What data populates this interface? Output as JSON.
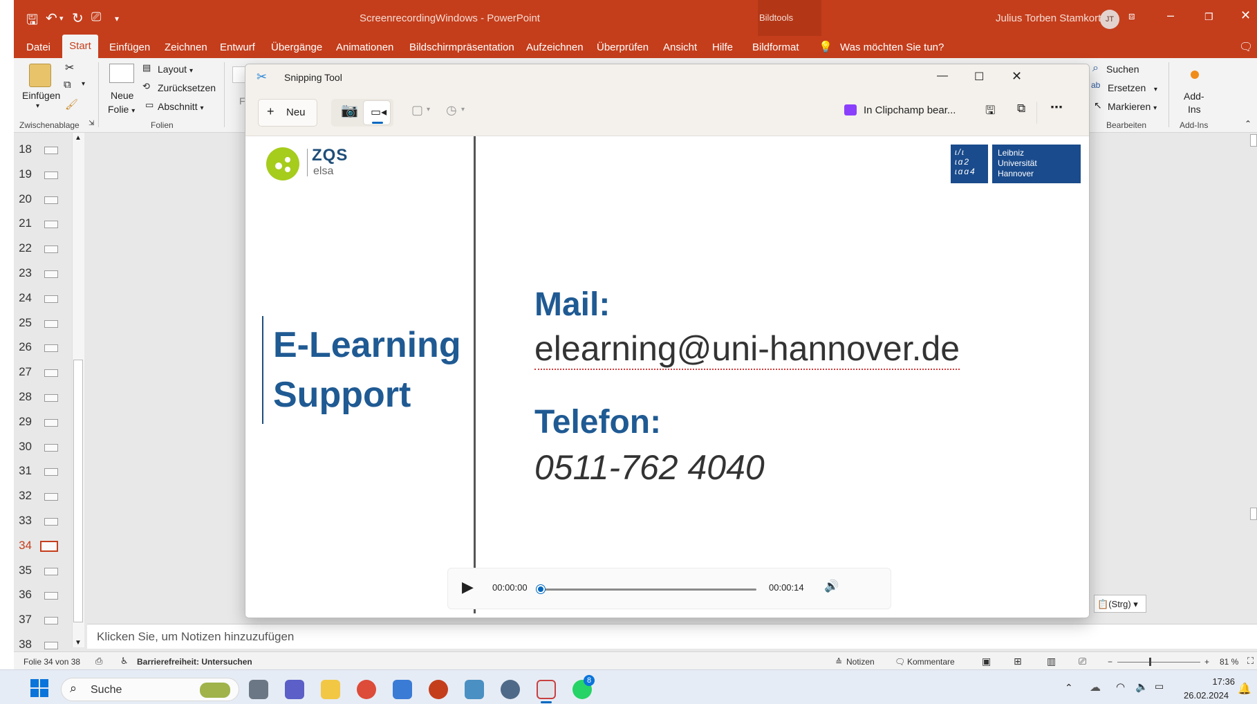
{
  "app": {
    "window_title": "ScreenrecordingWindows",
    "separator": "-",
    "app_name": "PowerPoint",
    "context_tab_group": "Bildtools",
    "user_name": "Julius Torben Stamkort",
    "user_initials": "JT"
  },
  "menu": {
    "items": [
      "Datei",
      "Start",
      "Einfügen",
      "Zeichnen",
      "Entwurf",
      "Übergänge",
      "Animationen",
      "Bildschirmpräsentation",
      "Aufzeichnen",
      "Überprüfen",
      "Ansicht",
      "Hilfe",
      "Bildformat"
    ],
    "active": "Start",
    "tell_me": "Was möchten Sie tun?"
  },
  "ribbon": {
    "paste_label": "Einfügen",
    "clipboard_group": "Zwischenablage",
    "new_slide_line1": "Neue",
    "new_slide_line2": "Folie",
    "layout": "Layout",
    "reset": "Zurücksetzen",
    "section": "Abschnitt",
    "slides_group": "Folien",
    "font_placeholder": "F",
    "find": "Suchen",
    "replace": "Ersetzen",
    "select": "Markieren",
    "editing_group": "Bearbeiten",
    "addins_line1": "Add-",
    "addins_line2": "Ins",
    "addins_group": "Add-Ins"
  },
  "thumbnails": {
    "numbers": [
      "18",
      "19",
      "20",
      "21",
      "22",
      "23",
      "24",
      "25",
      "26",
      "27",
      "28",
      "29",
      "30",
      "31",
      "32",
      "33",
      "34",
      "35",
      "36",
      "37",
      "38"
    ],
    "active": "34"
  },
  "notes_placeholder": "Klicken Sie, um Notizen hinzuzufügen",
  "paste_options": "(Strg)",
  "status": {
    "slide_info": "Folie 34 von 38",
    "accessibility": "Barrierefreiheit: Untersuchen",
    "notes": "Notizen",
    "comments": "Kommentare",
    "zoom": "81 %"
  },
  "snipping_tool": {
    "title": "Snipping Tool",
    "new_button": "Neu",
    "clipchamp_button": "In Clipchamp bear...",
    "player": {
      "current_time": "00:00:00",
      "total_time": "00:00:14",
      "progress": 0
    }
  },
  "slide": {
    "zqs_logo_text": "ZQS",
    "zqs_sub": "elsa",
    "luh_lines": [
      "Leibniz",
      "Universität",
      "Hannover"
    ],
    "title_line1": "E-Learning",
    "title_line2": "Support",
    "mail_label": "Mail:",
    "mail_value": "elearning@uni-hannover.de",
    "phone_label": "Telefon:",
    "phone_value": "0511-762 4040"
  },
  "taskbar": {
    "search": "Suche",
    "time": "17:36",
    "date": "26.02.2024",
    "whatsapp_badge": "8"
  },
  "colors": {
    "ppt_accent": "#c43e1c",
    "slide_blue": "#1f5a93",
    "luh_blue": "#1a4b8c",
    "zqs_green": "#a6cc1c"
  }
}
